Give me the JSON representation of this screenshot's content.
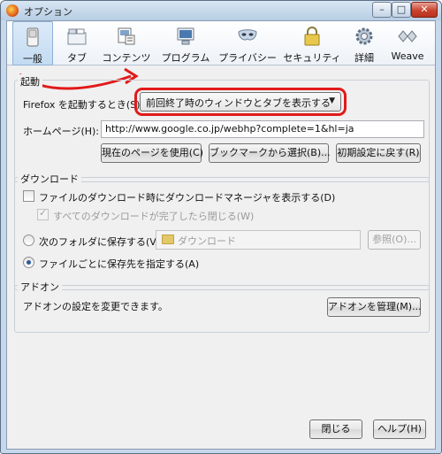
{
  "window": {
    "title": "オプション",
    "min": "–",
    "max": "□",
    "close": "✕"
  },
  "toolbar": [
    {
      "label": "一般",
      "icon": "switch-icon",
      "selected": true
    },
    {
      "label": "タブ",
      "icon": "tab-icon"
    },
    {
      "label": "コンテンツ",
      "icon": "content-icon"
    },
    {
      "label": "プログラム",
      "icon": "applications-icon"
    },
    {
      "label": "プライバシー",
      "icon": "privacy-mask-icon"
    },
    {
      "label": "セキュリティ",
      "icon": "lock-icon"
    },
    {
      "label": "詳細",
      "icon": "gear-icon"
    },
    {
      "label": "Weave",
      "icon": "weave-icon"
    }
  ],
  "startup": {
    "section_title": "起動",
    "when_label": "Firefox を起動するとき(S):",
    "when_value": "前回終了時のウィンドウとタブを表示する",
    "homepage_label": "ホームページ(H):",
    "homepage_value": "http://www.google.co.jp/webhp?complete=1&hl=ja",
    "use_current": "現在のページを使用(C)",
    "use_bookmark": "ブックマークから選択(B)...",
    "restore_default": "初期設定に戻す(R)"
  },
  "downloads": {
    "section_title": "ダウンロード",
    "show_manager": "ファイルのダウンロード時にダウンロードマネージャを表示する(D)",
    "close_when_done": "すべてのダウンロードが完了したら閉じる(W)",
    "save_to_label": "次のフォルダに保存する(V)",
    "save_to_folder": "ダウンロード",
    "browse": "参照(O)...",
    "always_ask": "ファイルごとに保存先を指定する(A)"
  },
  "addons": {
    "section_title": "アドオン",
    "description": "アドオンの設定を変更できます。",
    "manage": "アドオンを管理(M)..."
  },
  "footer": {
    "close": "閉じる",
    "help": "ヘルプ(H)"
  },
  "colors": {
    "annotation": "#e11a1a",
    "selected_tab": "#c3dbf2"
  }
}
